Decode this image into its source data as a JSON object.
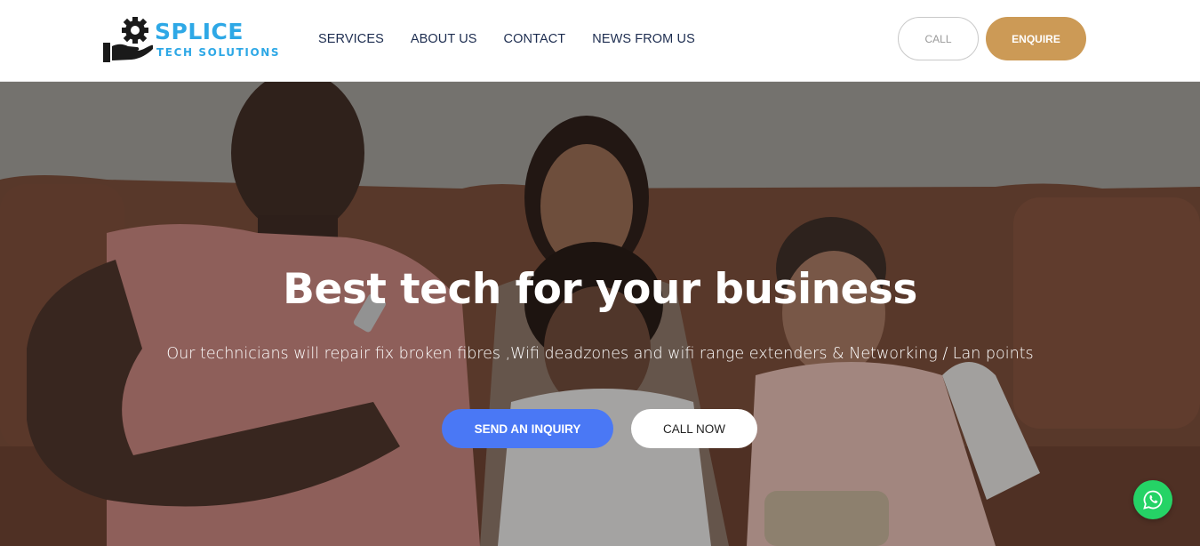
{
  "brand": {
    "name": "SPLICE",
    "tagline": "TECH SOLUTIONS",
    "color": "#2ea8e6"
  },
  "nav": {
    "items": [
      "SERVICES",
      "ABOUT US",
      "CONTACT",
      "NEWS FROM US"
    ]
  },
  "header_actions": {
    "call_label": "CALL",
    "enquire_label": "ENQUIRE",
    "enquire_color": "#cc9a56"
  },
  "hero": {
    "title": "Best tech for your business",
    "subtitle": "Our technicians will repair fix broken fibres ,Wifi deadzones and wifi range extenders & Networking / Lan points",
    "primary_button": "SEND AN INQUIRY",
    "secondary_button": "CALL NOW",
    "primary_color": "#4a78f5"
  },
  "floating": {
    "icon": "whatsapp-icon",
    "color": "#25d366"
  }
}
